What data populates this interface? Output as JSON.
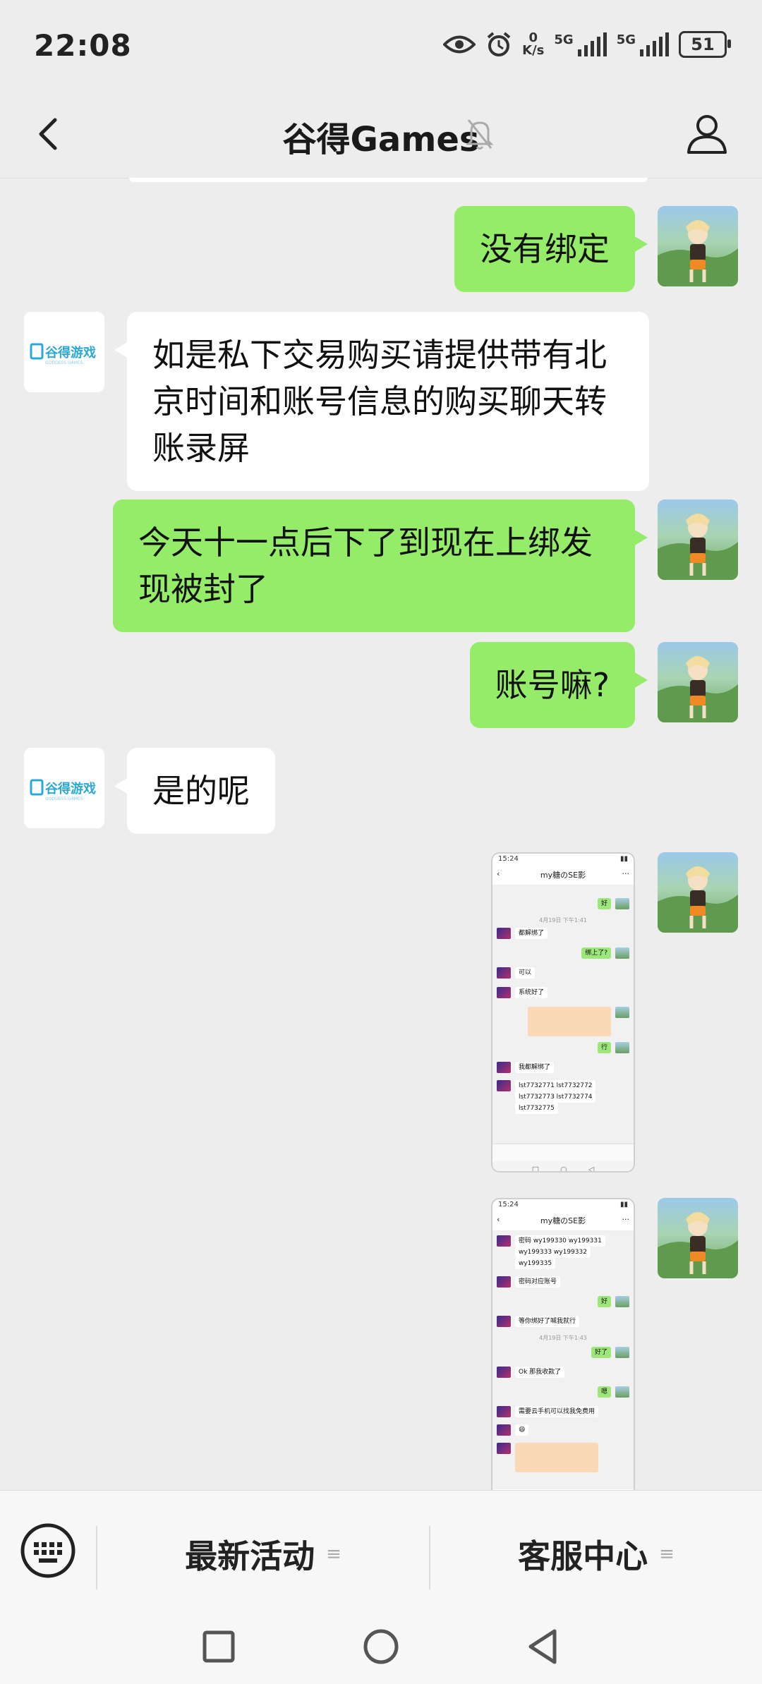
{
  "status": {
    "time": "22:08",
    "net_speed_value": "0",
    "net_speed_unit": "K/s",
    "signal1_label": "5G",
    "signal2_label": "5G",
    "battery": "51"
  },
  "header": {
    "title": "谷得Games"
  },
  "messages": [
    {
      "side": "me",
      "text": "没有绑定"
    },
    {
      "side": "them",
      "text": "如是私下交易购买请提供带有北京时间和账号信息的购买聊天转账录屏"
    },
    {
      "side": "me",
      "text": "今天十一点后下了到现在上绑发现被封了"
    },
    {
      "side": "me",
      "text": "账号嘛?"
    },
    {
      "side": "them",
      "text": "是的呢"
    }
  ],
  "screenshot1": {
    "time": "15:24",
    "title": "my糖のSE影",
    "lines": [
      "好",
      "都解绑了",
      "绑上了?",
      "可以",
      "系统好了",
      "行",
      "我都解绑了",
      "lst7732771   lst7732772",
      "lst7732773   lst7732774",
      "lst7732775"
    ],
    "timestamp": "4月19日 下午1:41"
  },
  "screenshot2": {
    "time": "15:24",
    "title": "my糖のSE影",
    "lines": [
      "密码 wy199330   wy199331",
      "wy199333   wy199332",
      "wy199335",
      "密码对应账号",
      "好",
      "等你绑好了喊我就行",
      "好了",
      "Ok 那我收款了",
      "嗯",
      "需要云手机可以找我免费用",
      "😄"
    ],
    "timestamp": "4月19日 下午1:43"
  },
  "bottom_menu": {
    "item1": "最新活动",
    "item2": "客服中心",
    "menu_glyph": "≡"
  },
  "colors": {
    "my_bubble": "#95ec69",
    "their_bubble": "#ffffff",
    "background": "#ededed"
  }
}
